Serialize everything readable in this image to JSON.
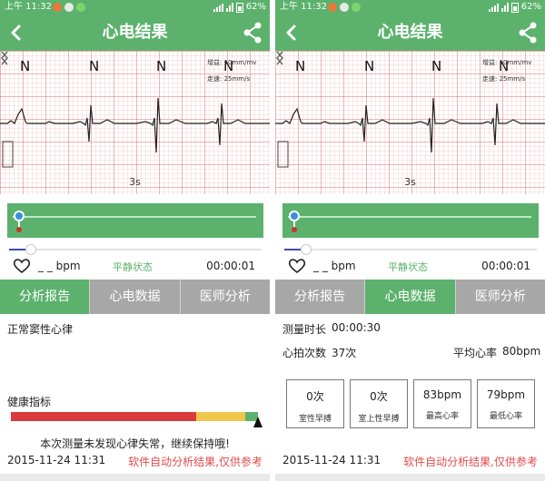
{
  "status_bar": {
    "time": "上午 11:32",
    "battery": "62%"
  },
  "colors": {
    "primary_green": "#5cb26d",
    "tab_inactive": "#a7a7a7",
    "note_red": "#e04b4b",
    "health_red": "#d93c3c",
    "health_yellow": "#f0c74a",
    "health_green": "#5cb26d"
  },
  "title_bar": {
    "title": "心电结果",
    "back_icon": "chevron-left-icon",
    "share_icon": "share-icon"
  },
  "ecg": {
    "beat_labels": [
      "N",
      "N",
      "N",
      "N"
    ],
    "gain_label": "增益: 10mm/mv",
    "speed_label": "走速: 25mm/s",
    "time_window": "3s"
  },
  "player": {
    "bpm": "_ _ bpm",
    "state": "平静状态",
    "timer": "00:00:01"
  },
  "tabs": [
    "分析报告",
    "心电数据",
    "医师分析"
  ],
  "report": {
    "rhythm": "正常窦性心律",
    "health_label": "健康指标",
    "message": "本次测量未发现心律失常，继续保持哦!",
    "health_levels": {
      "red": 0.75,
      "yellow": 0.2,
      "green": 0.05
    }
  },
  "ecg_data": {
    "duration_label": "测量时长",
    "duration_value": "00:00:30",
    "beats_label": "心拍次数",
    "beats_value": "37次",
    "avg_label": "平均心率",
    "avg_value": "80bpm",
    "metrics": [
      {
        "value": "0次",
        "label": "室性早搏"
      },
      {
        "value": "0次",
        "label": "室上性早搏"
      },
      {
        "value": "83bpm",
        "label": "最高心率"
      },
      {
        "value": "79bpm",
        "label": "最低心率"
      }
    ]
  },
  "footer": {
    "date": "2015-11-24 11:31",
    "note": "软件自动分析结果,仅供参考"
  }
}
